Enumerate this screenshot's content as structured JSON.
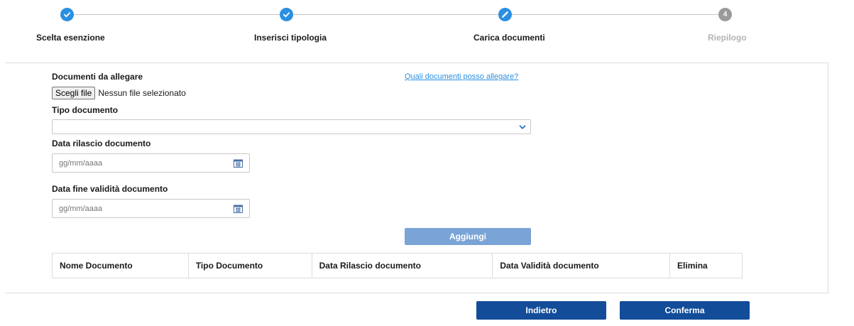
{
  "stepper": {
    "steps": [
      {
        "label": "Scelta esenzione",
        "state": "completed",
        "icon": "check-icon"
      },
      {
        "label": "Inserisci tipologia",
        "state": "completed",
        "icon": "check-icon"
      },
      {
        "label": "Carica documenti",
        "state": "current",
        "icon": "pencil-icon"
      },
      {
        "label": "Riepilogo",
        "state": "pending",
        "number": "4"
      }
    ],
    "colors": {
      "active": "#2b8fe0",
      "inactive": "#9a9a9a"
    }
  },
  "form": {
    "documents_label": "Documenti da allegare",
    "help_link": "Quali documenti posso allegare?",
    "file_button": "Scegli file",
    "file_status": "Nessun file selezionato",
    "doc_type_label": "Tipo documento",
    "doc_type_value": "",
    "issue_date_label": "Data rilascio documento",
    "issue_date_placeholder": "gg/mm/aaaa",
    "expiry_date_label": "Data fine validità documento",
    "expiry_date_placeholder": "gg/mm/aaaa",
    "add_button": "Aggiungi"
  },
  "table": {
    "columns": [
      "Nome Documento",
      "Tipo Documento",
      "Data Rilascio documento",
      "Data Validità documento",
      "Elimina"
    ],
    "rows": []
  },
  "footer": {
    "back_button": "Indietro",
    "confirm_button": "Conferma"
  },
  "colors": {
    "link": "#2b8fe0",
    "primary_button": "#134c99",
    "add_button_disabled": "#7aa4d6"
  }
}
